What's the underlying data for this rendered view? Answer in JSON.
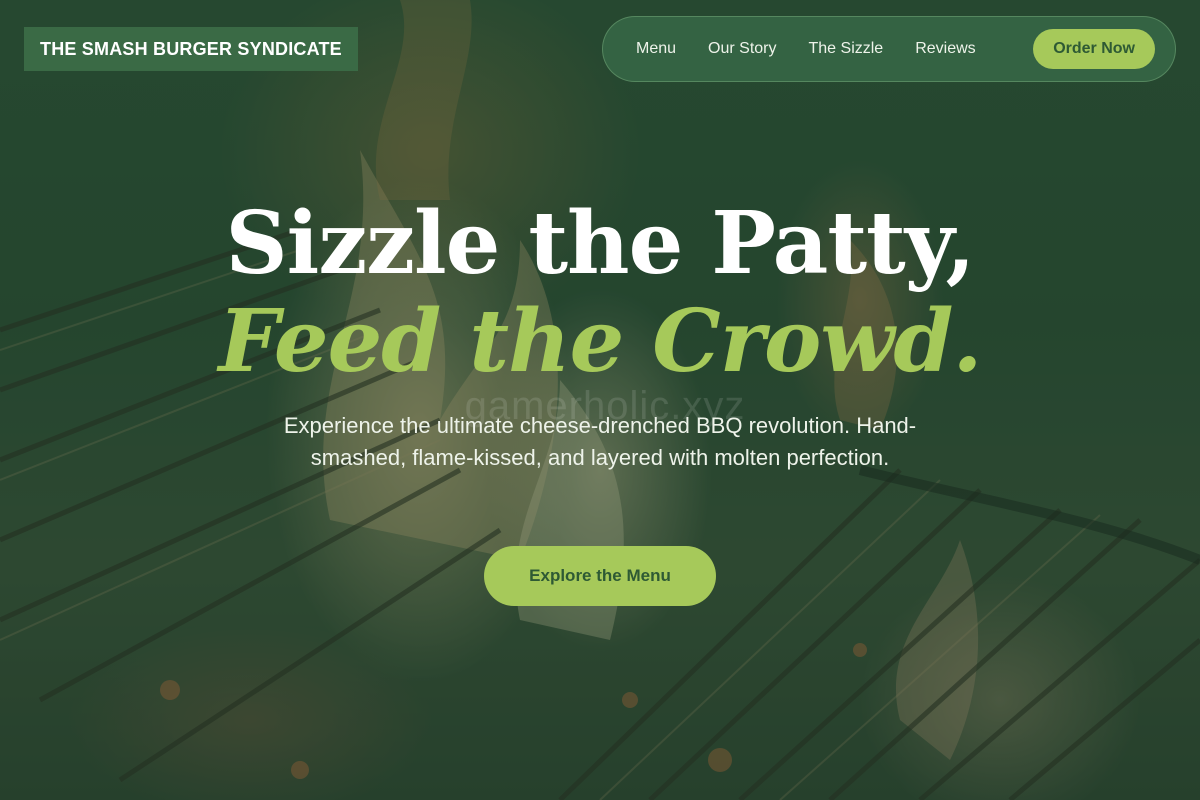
{
  "brand": {
    "name": "THE SMASH BURGER SYNDICATE"
  },
  "nav": {
    "links": [
      "Menu",
      "Our Story",
      "The Sizzle",
      "Reviews"
    ],
    "order_label": "Order Now"
  },
  "hero": {
    "title_line1": "Sizzle the Patty,",
    "title_line2": "Feed the Crowd.",
    "subtitle": "Experience the ultimate cheese-drenched BBQ revolution. Hand-smashed, flame-kissed, and layered with molten perfection.",
    "cta_label": "Explore the Menu",
    "watermark": "gamerholic.xyz"
  },
  "colors": {
    "brand_green": "#3a6a45",
    "accent_lime": "#a6c95a",
    "button_text": "#2e5a34"
  }
}
